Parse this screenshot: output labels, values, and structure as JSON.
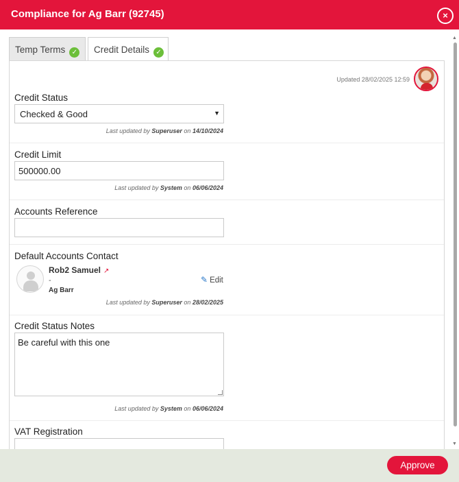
{
  "header": {
    "title": "Compliance for Ag Barr (92745)",
    "close_glyph": "×"
  },
  "tabs": [
    {
      "label": "Temp Terms",
      "status_glyph": "✓"
    },
    {
      "label": "Credit Details",
      "status_glyph": "✓"
    }
  ],
  "panel": {
    "updated": "Updated 28/02/2025 12:59",
    "credit_status": {
      "label": "Credit Status",
      "value": "Checked & Good",
      "meta": {
        "prefix": "Last updated by",
        "user": "Superuser",
        "on": "on",
        "date": "14/10/2024"
      }
    },
    "credit_limit": {
      "label": "Credit Limit",
      "value": "500000.00",
      "meta": {
        "prefix": "Last updated by",
        "user": "System",
        "on": "on",
        "date": "06/06/2024"
      }
    },
    "accounts_reference": {
      "label": "Accounts Reference",
      "value": ""
    },
    "default_accounts_contact": {
      "label": "Default Accounts Contact",
      "name": "Rob2 Samuel",
      "dash": "-",
      "company": "Ag Barr",
      "edit_label": "Edit",
      "meta": {
        "prefix": "Last updated by",
        "user": "Superuser",
        "on": "on",
        "date": "28/02/2025"
      }
    },
    "credit_status_notes": {
      "label": "Credit Status Notes",
      "value": "Be careful with this one",
      "meta": {
        "prefix": "Last updated by",
        "user": "System",
        "on": "on",
        "date": "06/06/2024"
      }
    },
    "vat_registration": {
      "label": "VAT Registration",
      "value": ""
    }
  },
  "footer": {
    "approve_label": "Approve"
  },
  "icons": {
    "close": "close-icon",
    "check": "check-circle-icon",
    "external_link": "external-link-icon",
    "pencil": "pencil-icon",
    "user_avatar": "user-avatar-icon",
    "contact_avatar": "person-placeholder-icon"
  },
  "colors": {
    "brand": "#e3153b",
    "success": "#6cbf3a",
    "footer_bg": "#e4e9df",
    "link": "#2a78c8"
  }
}
